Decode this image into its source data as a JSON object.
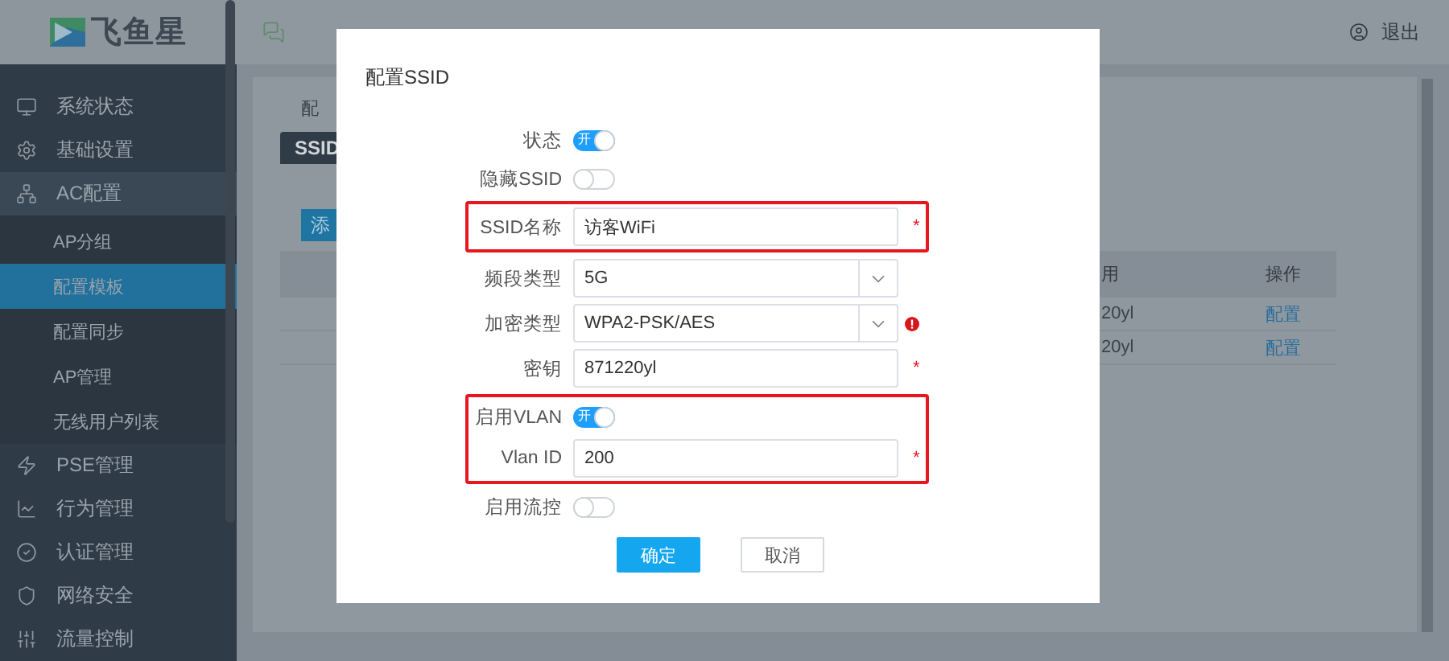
{
  "sidebar": {
    "logo": "飞鱼星",
    "items": [
      {
        "label": "系统状态",
        "selected": false
      },
      {
        "label": "基础设置",
        "selected": false
      },
      {
        "label": "AC配置",
        "selected": false,
        "expanded": true,
        "children": [
          {
            "label": "AP分组",
            "selected": false
          },
          {
            "label": "配置模板",
            "selected": true
          },
          {
            "label": "配置同步",
            "selected": false
          },
          {
            "label": "AP管理",
            "selected": false
          },
          {
            "label": "无线用户列表",
            "selected": false
          }
        ]
      },
      {
        "label": "PSE管理",
        "selected": false
      },
      {
        "label": "行为管理",
        "selected": false
      },
      {
        "label": "认证管理",
        "selected": false
      },
      {
        "label": "网络安全",
        "selected": false
      },
      {
        "label": "流量控制",
        "selected": false
      }
    ]
  },
  "header": {
    "logout": "退出"
  },
  "page": {
    "breadcrumb": "配",
    "tabs": [
      {
        "label": "SSID",
        "selected": true
      }
    ],
    "add_button": "添",
    "table": {
      "columns": [
        "用",
        "操作"
      ],
      "rows": [
        [
          "20yl",
          "配置"
        ],
        [
          "20yl",
          "配置"
        ]
      ]
    }
  },
  "dialog": {
    "title": "配置SSID",
    "groups": [
      {
        "highlighted": false,
        "fields": [
          {
            "kind": "toggle",
            "label": "状态",
            "on": true,
            "on_text": "开"
          },
          {
            "kind": "toggle",
            "label": "隐藏SSID",
            "on": false
          }
        ]
      },
      {
        "highlighted": true,
        "fields": [
          {
            "kind": "input",
            "label": "SSID名称",
            "value": "访客WiFi",
            "mark": "*"
          }
        ]
      },
      {
        "highlighted": false,
        "fields": [
          {
            "kind": "select",
            "label": "频段类型",
            "value": "5G",
            "warning": false
          },
          {
            "kind": "select",
            "label": "加密类型",
            "value": "WPA2-PSK/AES",
            "warning": true
          },
          {
            "kind": "input",
            "label": "密钥",
            "value": "871220yl",
            "mark": "*"
          }
        ]
      },
      {
        "highlighted": true,
        "fields": [
          {
            "kind": "toggle",
            "label": "启用VLAN",
            "on": true,
            "on_text": "开"
          },
          {
            "kind": "input",
            "label": "Vlan ID",
            "value": "200",
            "mark": "*"
          }
        ]
      },
      {
        "highlighted": false,
        "fields": [
          {
            "kind": "toggle",
            "label": "启用流控",
            "on": false
          }
        ]
      }
    ],
    "buttons": [
      {
        "label": "确定",
        "kind": "primary"
      },
      {
        "label": "取消",
        "kind": "default"
      }
    ]
  }
}
